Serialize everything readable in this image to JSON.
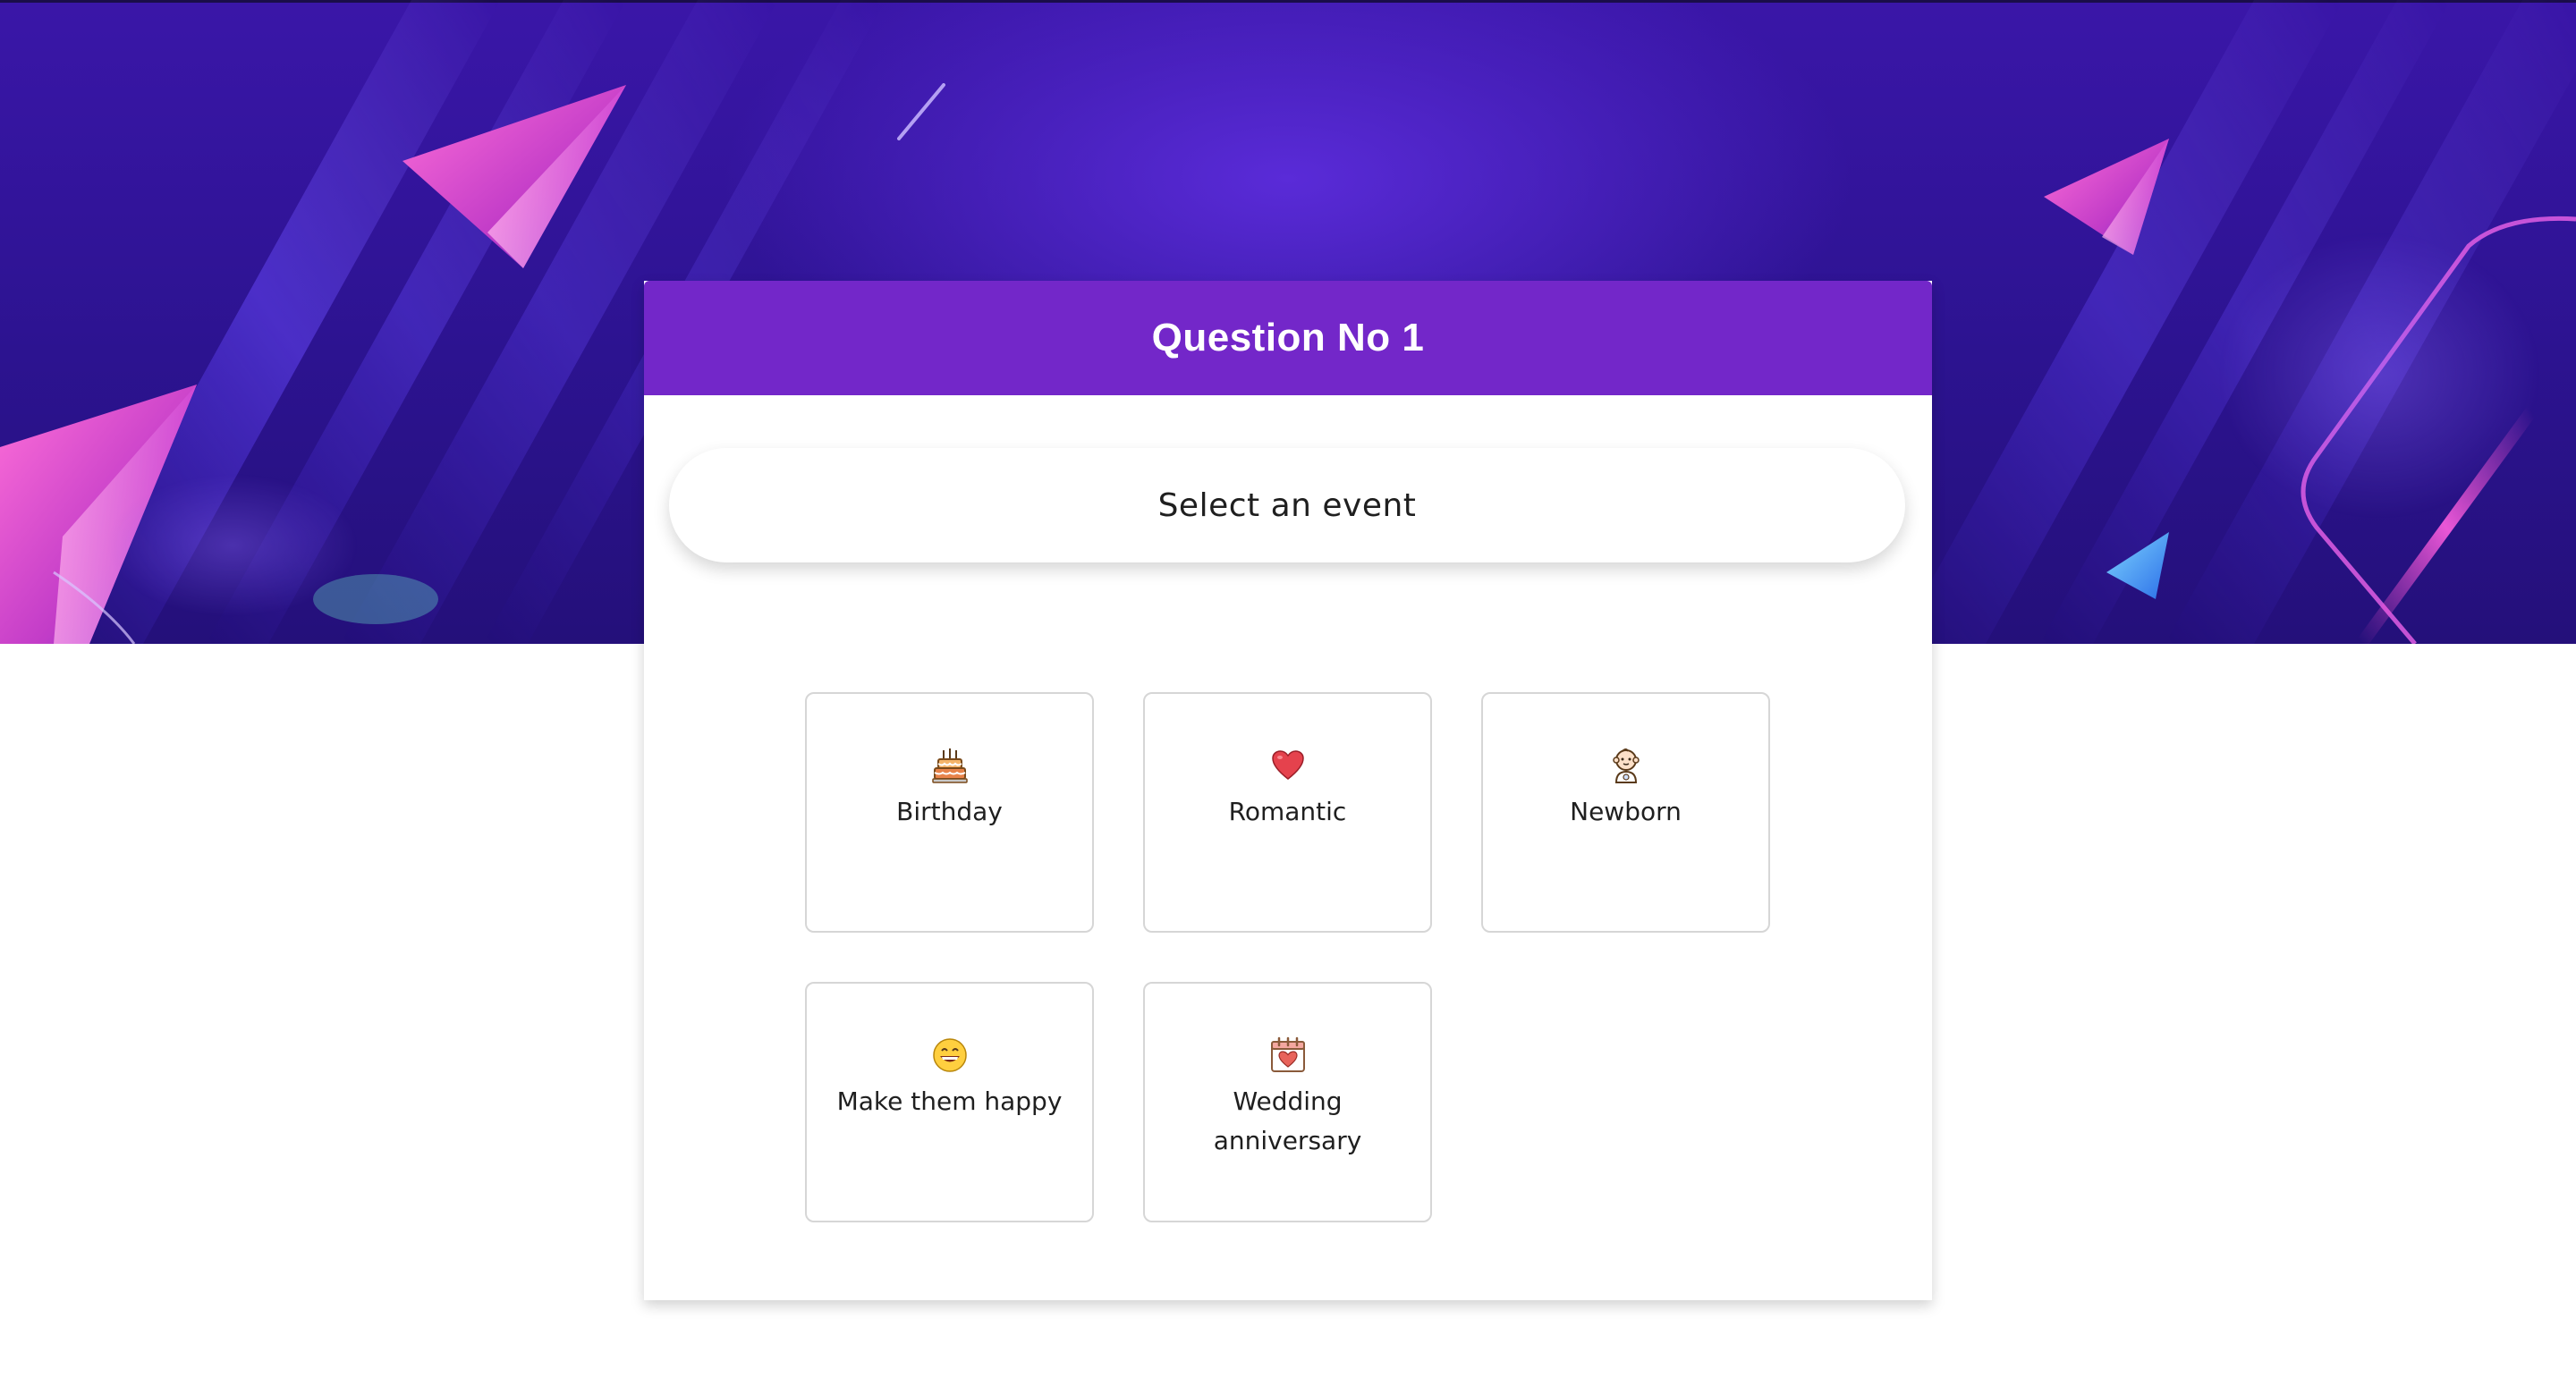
{
  "hero": {
    "colors": {
      "background_top": "#3a16a8",
      "background_bottom": "#24107a",
      "accent_magenta": "#e84fd8",
      "accent_blue": "#3aa0f0"
    }
  },
  "quiz": {
    "title": "Question No 1",
    "prompt": "Select an event",
    "header_color": "#7327c9",
    "options": [
      {
        "label": "Birthday",
        "icon": "birthday-cake-icon"
      },
      {
        "label": "Romantic",
        "icon": "heart-icon"
      },
      {
        "label": "Newborn",
        "icon": "baby-icon"
      },
      {
        "label": "Make them happy",
        "icon": "smiley-face-icon"
      },
      {
        "label": "Wedding anniversary",
        "icon": "calendar-heart-icon"
      }
    ]
  }
}
